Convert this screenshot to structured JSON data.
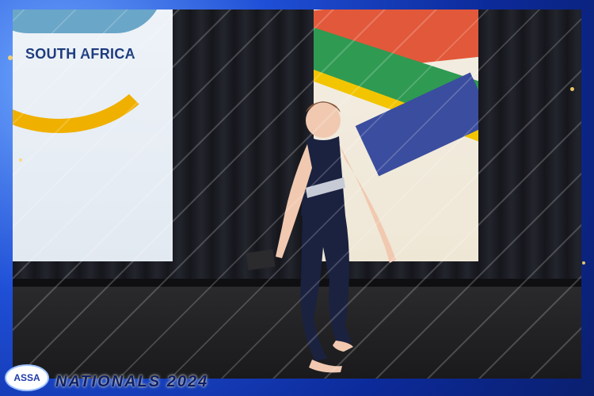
{
  "banner": {
    "left_text": "SOUTH AFRICA"
  },
  "logo": {
    "text": "ASSA"
  },
  "event": {
    "title": "NATIONALS 2024"
  },
  "colors": {
    "frame_blue": "#1f4fd6",
    "title_yellow": "#ffd66b",
    "flag_red": "#e2583a",
    "flag_green": "#2f9a52",
    "flag_yellow": "#f2c500",
    "flag_blue": "#3b4d9e"
  }
}
